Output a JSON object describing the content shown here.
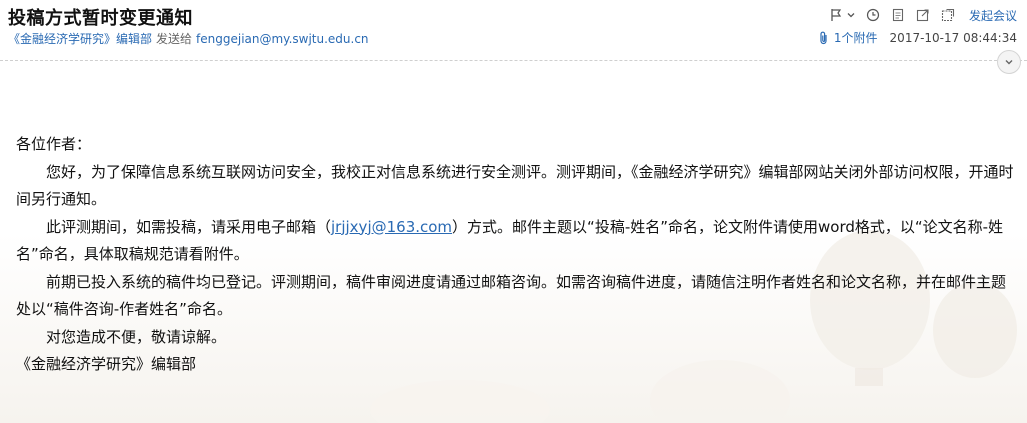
{
  "header": {
    "subject": "投稿方式暂时变更通知",
    "sender_name": "《金融经济学研究》编辑部",
    "sent_to_label": "发送给",
    "recipient": "fenggejian@my.swjtu.edu.cn",
    "meeting_link": "发起会议",
    "attachment_label": "1个附件",
    "datetime": "2017-10-17 08:44:34"
  },
  "icons": [
    "flag-icon",
    "chevron-down-icon",
    "clock-icon",
    "document-icon",
    "share-icon",
    "new-window-icon",
    "paperclip-icon",
    "expand-chevron-icon"
  ],
  "body": {
    "greeting": "各位作者：",
    "p1": "您好，为了保障信息系统互联网访问安全，我校正对信息系统进行安全测评。测评期间，《金融经济学研究》编辑部网站关闭外部访问权限，开通时间另行通知。",
    "p2_before": "此评测期间，如需投稿，请采用电子邮箱（",
    "p2_email": "jrjjxyj@163.com",
    "p2_after": "）方式。邮件主题以“投稿-姓名”命名，论文附件请使用word格式，以“论文名称-姓名”命名，具体取稿规范请看附件。",
    "p3": "前期已投入系统的稿件均已登记。评测期间，稿件审阅进度请通过邮箱咨询。如需咨询稿件进度，请随信注明作者姓名和论文名称，并在邮件主题处以“稿件咨询-作者姓名”命名。",
    "p4": "对您造成不便，敬请谅解。",
    "signature": "《金融经济学研究》编辑部"
  },
  "colors": {
    "link": "#2a6ab3",
    "text": "#111111",
    "divider": "#cfcfcf"
  }
}
